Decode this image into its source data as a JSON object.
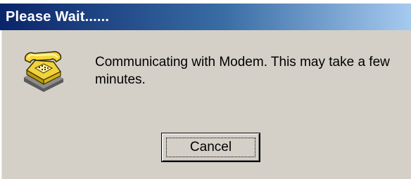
{
  "dialog": {
    "title": "Please Wait......",
    "message": "Communicating with Modem. This may take a few minutes.",
    "icon": "telephone-icon",
    "cancel_label": "Cancel"
  },
  "colors": {
    "titlebar_start": "#0a246a",
    "titlebar_end": "#a6caf0",
    "client_background": "#d4d0c8"
  }
}
